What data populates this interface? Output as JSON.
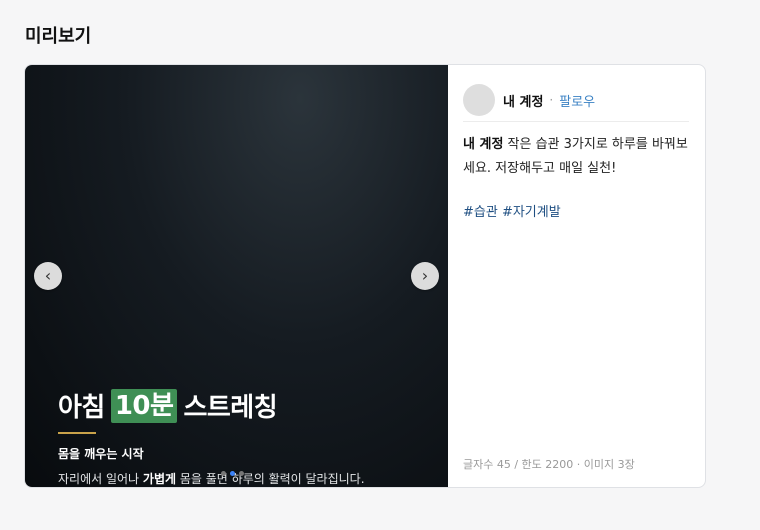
{
  "preview": {
    "title": "미리보기"
  },
  "carousel": {
    "prev_icon": "‹",
    "next_icon": "›",
    "headline_before": "아침",
    "headline_highlight": "10분",
    "headline_after": "스트레칭",
    "subheadline": "몸을 깨우는 시작",
    "desc_before": "자리에서 일어나 ",
    "desc_bold": "가볍게",
    "desc_after": " 몸을 풀면 하루의 활력이 달라집니다.",
    "slide_count": 3,
    "active_slide": 2,
    "colors": {
      "highlight_bg": "#3f8f55",
      "accent_line": "#c9a24a",
      "active_dot": "#3b82f6"
    }
  },
  "post": {
    "account_name": "내 계정",
    "separator": "·",
    "follow_label": "팔로우",
    "caption_account": "내 계정",
    "caption_text": " 작은 습관 3가지로 하루를 바꿔보세요. 저장해두고 매일 실천!",
    "hashtags": "#습관 #자기계발",
    "stats": "글자수 45 / 한도 2200 · 이미지 3장"
  }
}
